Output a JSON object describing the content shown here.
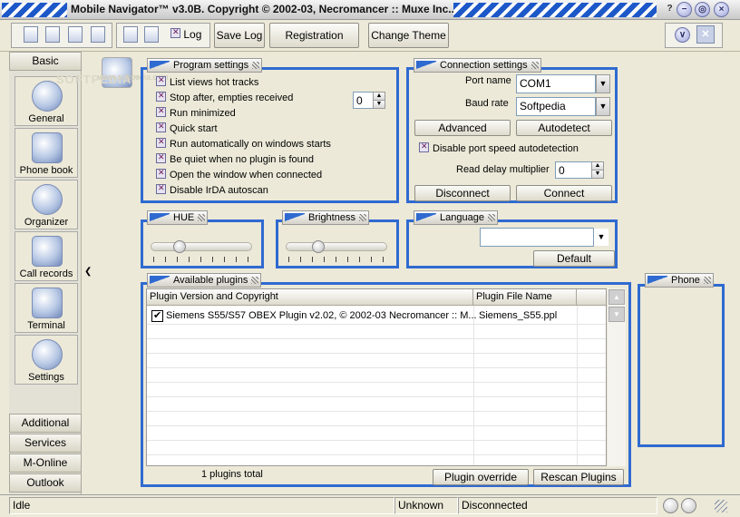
{
  "window": {
    "title": "Mobile Navigator™ v3.0B. Copyright © 2002-03, Necromancer :: Muxe Inc...",
    "controls": {
      "help": "?",
      "minimize": "−",
      "restore": "◎",
      "close": "×"
    }
  },
  "toolbar": {
    "log_label": "Log",
    "save_log_label": "Save Log",
    "registration_label": "Registration",
    "change_theme_label": "Change Theme"
  },
  "nav": {
    "basic": "Basic",
    "items": [
      {
        "label": "General",
        "icon": "globe-icon"
      },
      {
        "label": "Phone book",
        "icon": "phone-icon"
      },
      {
        "label": "Organizer",
        "icon": "clock-icon"
      },
      {
        "label": "Call records",
        "icon": "call-records-icon"
      },
      {
        "label": "Terminal",
        "icon": "terminal-icon"
      },
      {
        "label": "Settings",
        "icon": "gears-icon"
      }
    ],
    "sections": [
      "Additional",
      "Services",
      "M-Online",
      "Outlook"
    ]
  },
  "watermark": "SOFTPEDIA™",
  "watermark_url": "www.softpedia.com",
  "program_settings": {
    "title": "Program settings",
    "options": [
      "List views hot tracks",
      "Stop after, empties received",
      "Run minimized",
      "Quick start",
      "Run automatically on windows starts",
      "Be quiet when no plugin is found",
      "Open the window when connected",
      "Disable IrDA autoscan"
    ],
    "empties_value": "0"
  },
  "connection_settings": {
    "title": "Connection settings",
    "port_name_label": "Port name",
    "port_name_value": "COM1",
    "baud_rate_label": "Baud rate",
    "baud_rate_value": "Softpedia",
    "advanced_label": "Advanced",
    "autodetect_label": "Autodetect",
    "disable_autodetect_label": "Disable port speed autodetection",
    "read_delay_label": "Read delay multiplier",
    "read_delay_value": "0",
    "disconnect_label": "Disconnect",
    "connect_label": "Connect"
  },
  "hue": {
    "title": "HUE",
    "level": 0.25
  },
  "brightness": {
    "title": "Brightness",
    "level": 0.3
  },
  "language": {
    "title": "Language",
    "value": "",
    "default_label": "Default"
  },
  "plugins": {
    "title": "Available plugins",
    "columns": [
      "Plugin Version and Copyright",
      "Plugin File Name"
    ],
    "rows": [
      {
        "name": "Siemens S55/S57 OBEX Plugin v2.02, © 2002-03 Necromancer :: M...",
        "file": "Siemens_S55.ppl",
        "checked": true
      }
    ],
    "total": "1 plugins total",
    "override_label": "Plugin override",
    "rescan_label": "Rescan Plugins"
  },
  "phone": {
    "title": "Phone"
  },
  "status": {
    "state": "Idle",
    "model": "Unknown",
    "connection": "Disconnected"
  },
  "colors": {
    "accent": "#2f6ad0",
    "background": "#ece9d8"
  }
}
